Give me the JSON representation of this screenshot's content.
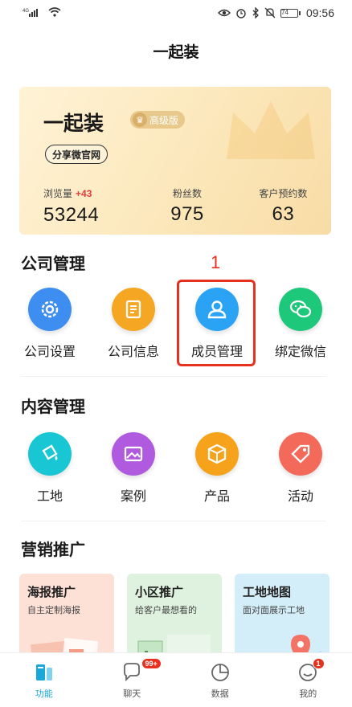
{
  "status_bar": {
    "signal": "4G",
    "time": "09:56",
    "battery": "74"
  },
  "header": {
    "title": "一起装"
  },
  "hero": {
    "name": "一起装",
    "badge": "高级版",
    "share_label": "分享微官网",
    "stats": [
      {
        "label": "浏览量",
        "delta": "+43",
        "value": "53244"
      },
      {
        "label": "粉丝数",
        "delta": "",
        "value": "975"
      },
      {
        "label": "客户预约数",
        "delta": "",
        "value": "63"
      }
    ]
  },
  "company": {
    "title": "公司管理",
    "items": [
      {
        "label": "公司设置",
        "icon": "gear-icon",
        "color": "#3d8ef0"
      },
      {
        "label": "公司信息",
        "icon": "document-icon",
        "color": "#f5a623"
      },
      {
        "label": "成员管理",
        "icon": "user-icon",
        "color": "#2ba3f5"
      },
      {
        "label": "绑定微信",
        "icon": "wechat-icon",
        "color": "#1ec87a"
      }
    ]
  },
  "annotation": {
    "number": "1"
  },
  "content": {
    "title": "内容管理",
    "items": [
      {
        "label": "工地",
        "icon": "paint-bucket-icon",
        "color": "#19c6d4"
      },
      {
        "label": "案例",
        "icon": "picture-icon",
        "color": "#b05ae0"
      },
      {
        "label": "产品",
        "icon": "box-icon",
        "color": "#f7a21b"
      },
      {
        "label": "活动",
        "icon": "tag-icon",
        "color": "#f46a5a"
      }
    ]
  },
  "marketing": {
    "title": "营销推广",
    "cards": [
      {
        "title": "海报推广",
        "subtitle": "自主定制海报",
        "color": "#fde0d6"
      },
      {
        "title": "小区推广",
        "subtitle": "给客户最想看的",
        "color": "#dff2df"
      },
      {
        "title": "工地地图",
        "subtitle": "面对面展示工地",
        "color": "#d4eef9"
      }
    ]
  },
  "tabbar": {
    "tabs": [
      {
        "label": "功能",
        "icon": "function-icon",
        "badge": ""
      },
      {
        "label": "聊天",
        "icon": "chat-icon",
        "badge": "99+"
      },
      {
        "label": "数据",
        "icon": "pie-chart-icon",
        "badge": ""
      },
      {
        "label": "我的",
        "icon": "profile-icon",
        "badge": "1"
      }
    ],
    "active_color": "#1aa8d8"
  }
}
